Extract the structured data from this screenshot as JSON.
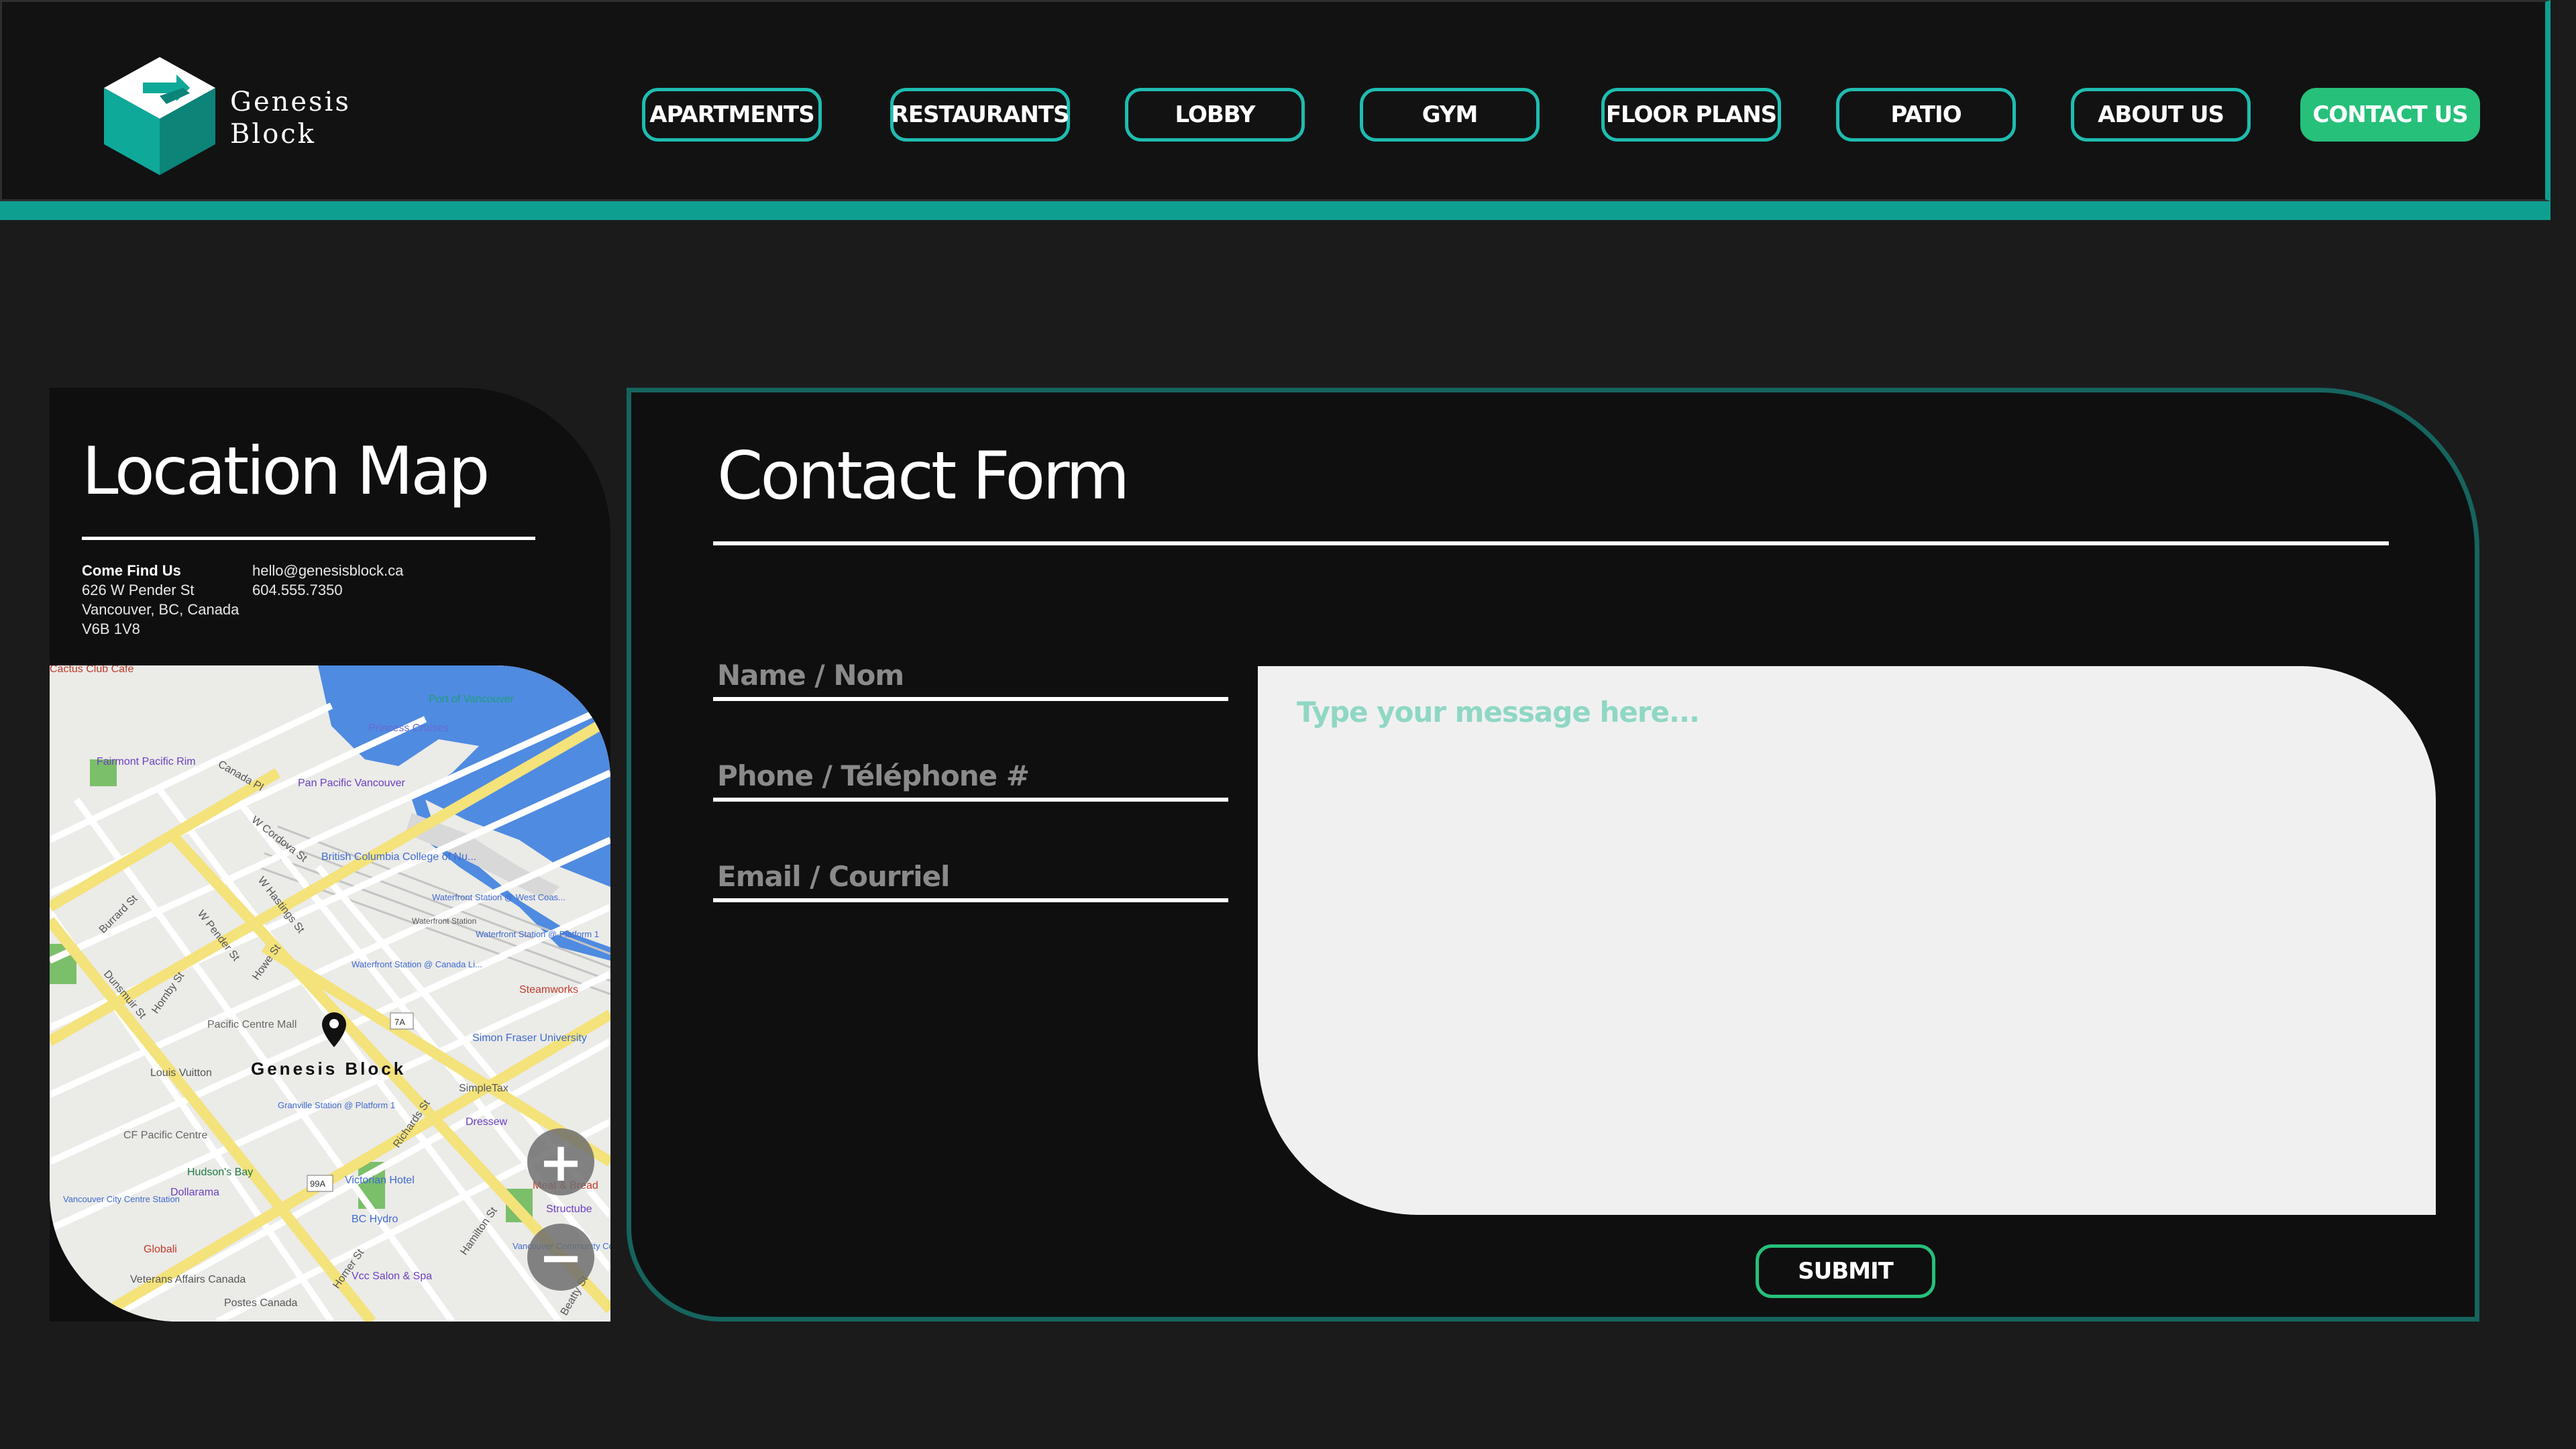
{
  "brand": {
    "name_line1": "Genesis",
    "name_line2": "Block",
    "accent_color": "#0f9f90",
    "logo_icon": "isometric-cube-logo"
  },
  "nav": {
    "items": [
      {
        "label": "APARTMENTS",
        "active": false
      },
      {
        "label": "RESTAURANTS",
        "active": false
      },
      {
        "label": "LOBBY",
        "active": false
      },
      {
        "label": "GYM",
        "active": false
      },
      {
        "label": "FLOOR PLANS",
        "active": false
      },
      {
        "label": "PATIO",
        "active": false
      },
      {
        "label": "ABOUT US",
        "active": false
      },
      {
        "label": "CONTACT US",
        "active": true
      }
    ],
    "active_color": "#26c07a",
    "border_color": "#1fbcb0"
  },
  "location": {
    "title": "Location Map",
    "find_us_heading": "Come Find Us",
    "address_line1": "626 W Pender St",
    "address_line2": "Vancouver, BC, Canada",
    "address_line3": "V6B 1V8",
    "email": "hello@genesisblock.ca",
    "phone": "604.555.7350",
    "map": {
      "pin_label": "Genesis Block",
      "zoom_in_icon": "plus-icon",
      "zoom_out_icon": "minus-icon",
      "street_labels": [
        "W Cordova St",
        "W Hastings St",
        "W Pender St",
        "Burrard St",
        "Dunsmuir St",
        "Hornby St",
        "Howe St",
        "Richards St",
        "Homer St",
        "Hamilton St",
        "Canada Pl",
        "Beatty St"
      ],
      "poi_labels": [
        "Cactus Club Cafe",
        "Port of Vancouver",
        "Princess Cruises",
        "Fairmont Pacific Rim",
        "Pan Pacific Vancouver",
        "British Columbia College of Nu...",
        "Waterfront Station @ West Coas...",
        "Waterfront Station",
        "Waterfront Station @ Platform 1",
        "Waterfront Station @ Canada Li...",
        "Steamworks",
        "Pacific Centre Mall",
        "Simon Fraser University",
        "Louis Vuitton",
        "SimpleTax",
        "Granville Station @ Platform 1",
        "Dressew",
        "CF Pacific Centre",
        "Hudson's Bay",
        "Victorian Hotel",
        "Meat & Bread",
        "Structube",
        "Dollarama",
        "BC Hydro",
        "Vancouver City Centre Station",
        "Vancouver Community College Co...",
        "Globali",
        "Vcc Salon & Spa",
        "Veterans Affairs Canada",
        "Postes Canada"
      ],
      "route_badges": [
        "7A",
        "99A"
      ]
    }
  },
  "contact": {
    "title": "Contact Form",
    "fields": [
      {
        "label": "Name / Nom"
      },
      {
        "label": "Phone / Téléphone #"
      },
      {
        "label": "Email / Courriel"
      }
    ],
    "message_placeholder": "Type your message here...",
    "submit_label": "SUBMIT"
  }
}
